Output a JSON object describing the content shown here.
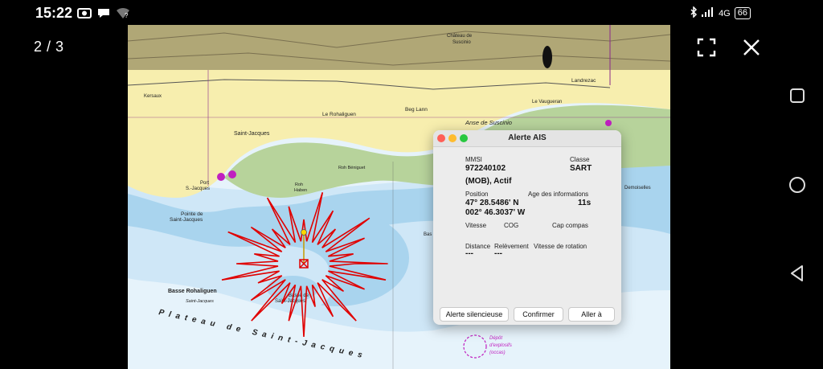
{
  "status_bar": {
    "time": "15:22",
    "network": "4G",
    "battery": "66"
  },
  "viewer": {
    "counter": "2 / 3"
  },
  "chart_labels": {
    "kersaux": "Kersaux",
    "saint_jacques": "Saint-Jacques",
    "le_rohaliguen": "Le Rohaliguen",
    "beg_lann": "Beg Lann",
    "chateau": "Château de",
    "suscinio_top": "Suscinio",
    "landrezac": "Landrezac",
    "le_vaugueran": "Le Vaugueran",
    "anse_suscinio": "Anse de Suscinio",
    "port": "Port",
    "s_jacques": "S.-Jacques",
    "pointe": "Pointe de",
    "saint_jacques2": "Saint-Jacques",
    "roh_beniguet": "Roh Béniguet",
    "roh_haben": "Roh",
    "haben": "Haben",
    "basse_rohaliguen": "Basse Rohaliguen",
    "saint_jacques_small": "Saint-Jacques",
    "basse_de": "Basse de",
    "saint_jacques3": "Saint-Jacques",
    "plateau": "Plateau de Saint-Jacques",
    "demoiselles": "Demoiselles",
    "depot": "Dépôt",
    "explosifs": "d'explosifs",
    "occas": "(occas)",
    "bas": "Bas"
  },
  "ais_alert": {
    "title": "Alerte AIS",
    "mmsi_label": "MMSI",
    "mmsi": "972240102",
    "classe_label": "Classe",
    "classe": "SART",
    "status": "(MOB), Actif",
    "position_label": "Position",
    "age_label": "Age des informations",
    "lat": "47° 28.5486' N",
    "lon": "002° 46.3037' W",
    "age": "11s",
    "vitesse_label": "Vitesse",
    "cog_label": "COG",
    "cap_label": "Cap compas",
    "distance_label": "Distance",
    "distance": "---",
    "relevement_label": "Relèvement",
    "relevement": "---",
    "vitesse_rot_label": "Vitesse de rotation",
    "btn_silence": "Alerte silencieuse",
    "btn_confirm": "Confirmer",
    "btn_goto": "Aller à"
  },
  "colors": {
    "land": "#f7eeae",
    "shallow": "#a9d4ee",
    "mid_water": "#cfe7f7",
    "deep_water": "#e6f3fb",
    "green_foreshore": "#b7d39b",
    "sart_red": "#e00000",
    "magenta": "#c020c0"
  }
}
